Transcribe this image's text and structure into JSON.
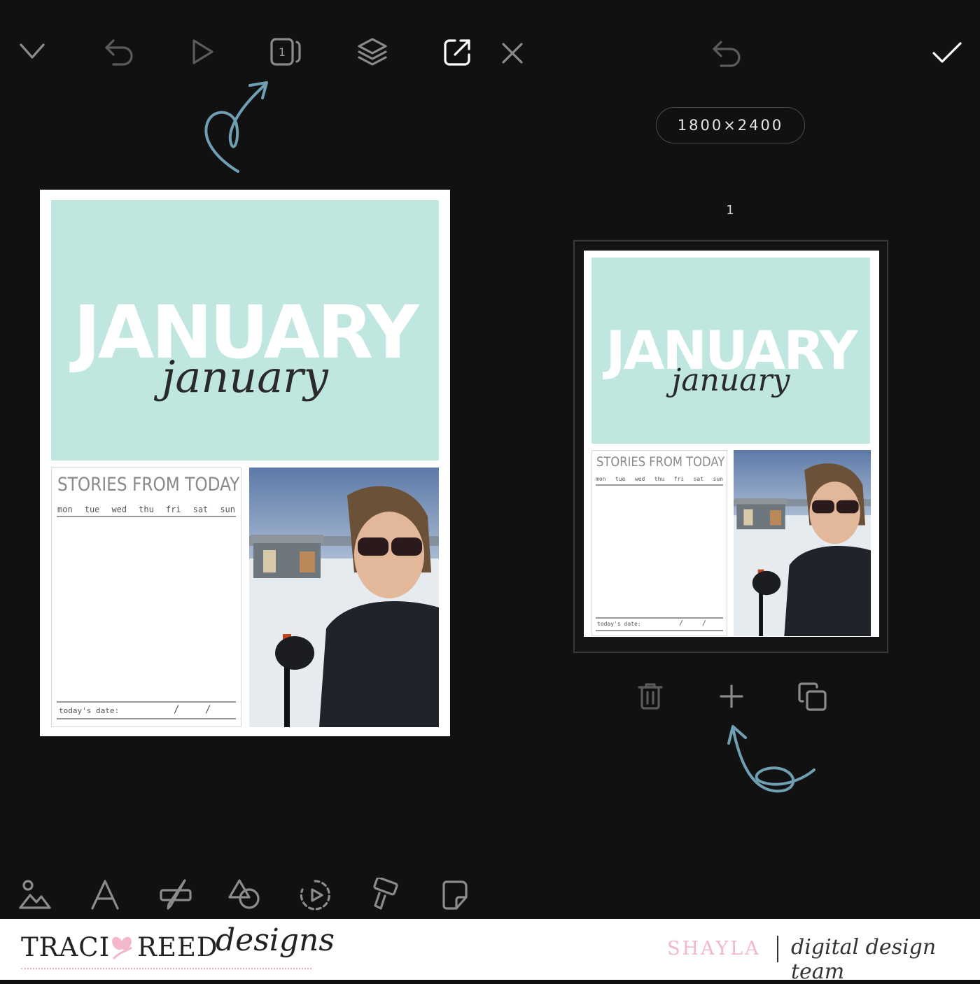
{
  "toolbar": {
    "left": [
      {
        "icon": "chevron-down-icon"
      },
      {
        "icon": "undo-icon"
      },
      {
        "icon": "play-icon"
      },
      {
        "icon": "pages-icon",
        "badge": "1"
      },
      {
        "icon": "layers-icon"
      },
      {
        "icon": "export-icon"
      },
      {
        "icon": "close-icon"
      }
    ],
    "right": [
      {
        "icon": "undo-icon"
      },
      {
        "icon": "checkmark-icon"
      }
    ]
  },
  "page_panel": {
    "size_label": "1800×2400",
    "page_number": "1",
    "actions": [
      "trash-icon",
      "plus-icon",
      "duplicate-icon"
    ]
  },
  "layout": {
    "title_big": "JANUARY",
    "title_script": "january",
    "journal_title": "STORIES FROM TODAY",
    "days": [
      "mon",
      "tue",
      "wed",
      "thu",
      "fri",
      "sat",
      "sun"
    ],
    "date_label": "today's date:",
    "date_sep": "/"
  },
  "bottom_tools": [
    "image-icon",
    "text-icon",
    "brush-icon",
    "shapes-icon",
    "animation-icon",
    "paint-icon",
    "sticker-icon"
  ],
  "footer": {
    "brand_part1": "TRACI",
    "brand_part2": "REED",
    "brand_script": "designs",
    "member_name": "SHAYLA",
    "team_label": "digital design team"
  },
  "colors": {
    "background": "#111112",
    "mint": "#bfe6df",
    "annotation_arrow": "#6f9fb3",
    "brand_pink": "#f3b7cb"
  }
}
